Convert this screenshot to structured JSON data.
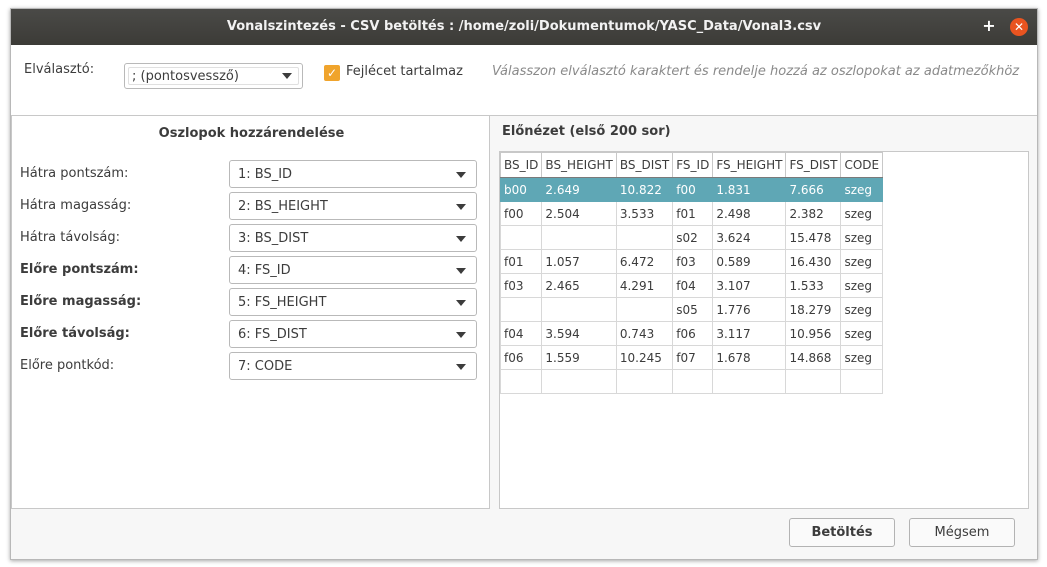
{
  "window": {
    "title": "Vonalszintezés - CSV betöltés : /home/zoli/Dokumentumok/YASC_Data/Vonal3.csv",
    "plus_glyph": "+",
    "close_glyph": "✕"
  },
  "top": {
    "separator_label": "Elválasztó:",
    "separator_value": "; (pontosvessző)",
    "header_checkbox_label": "Fejlécet tartalmaz",
    "header_checked": true,
    "check_glyph": "✓",
    "hint": "Válasszon elválasztó karaktert és rendelje hozzá az oszlopokat az adatmezőkhöz"
  },
  "mapping": {
    "title": "Oszlopok hozzárendelése",
    "rows": [
      {
        "label": "Hátra pontszám:",
        "value": "1: BS_ID",
        "bold": false
      },
      {
        "label": "Hátra magasság:",
        "value": "2: BS_HEIGHT",
        "bold": false
      },
      {
        "label": "Hátra távolság:",
        "value": "3: BS_DIST",
        "bold": false
      },
      {
        "label": "Előre pontszám:",
        "value": "4: FS_ID",
        "bold": true
      },
      {
        "label": "Előre magasság:",
        "value": "5: FS_HEIGHT",
        "bold": true
      },
      {
        "label": "Előre távolság:",
        "value": "6: FS_DIST",
        "bold": true
      },
      {
        "label": "Előre pontkód:",
        "value": "7: CODE",
        "bold": false
      }
    ]
  },
  "preview": {
    "title": "Előnézet (első 200 sor)",
    "columns": [
      "BS_ID",
      "BS_HEIGHT",
      "BS_DIST",
      "FS_ID",
      "FS_HEIGHT",
      "FS_DIST",
      "CODE"
    ],
    "rows": [
      [
        "b00",
        "2.649",
        "10.822",
        "f00",
        "1.831",
        "7.666",
        "szeg"
      ],
      [
        "f00",
        "2.504",
        "3.533",
        "f01",
        "2.498",
        "2.382",
        "szeg"
      ],
      [
        "",
        "",
        "",
        "s02",
        "3.624",
        "15.478",
        "szeg"
      ],
      [
        "f01",
        "1.057",
        "6.472",
        "f03",
        "0.589",
        "16.430",
        "szeg"
      ],
      [
        "f03",
        "2.465",
        "4.291",
        "f04",
        "3.107",
        "1.533",
        "szeg"
      ],
      [
        "",
        "",
        "",
        "s05",
        "1.776",
        "18.279",
        "szeg"
      ],
      [
        "f04",
        "3.594",
        "0.743",
        "f06",
        "3.117",
        "10.956",
        "szeg"
      ],
      [
        "f06",
        "1.559",
        "10.245",
        "f07",
        "1.678",
        "14.868",
        "szeg"
      ],
      [
        "",
        "",
        "",
        "",
        "",
        "",
        ""
      ]
    ],
    "selected_row": 0,
    "selection_color": "#5fa7b5"
  },
  "buttons": {
    "load": "Betöltés",
    "cancel": "Mégsem"
  },
  "colors": {
    "accent_close": "#e95420",
    "checkbox": "#f0a42c",
    "titlebar": "#3c3b37"
  }
}
